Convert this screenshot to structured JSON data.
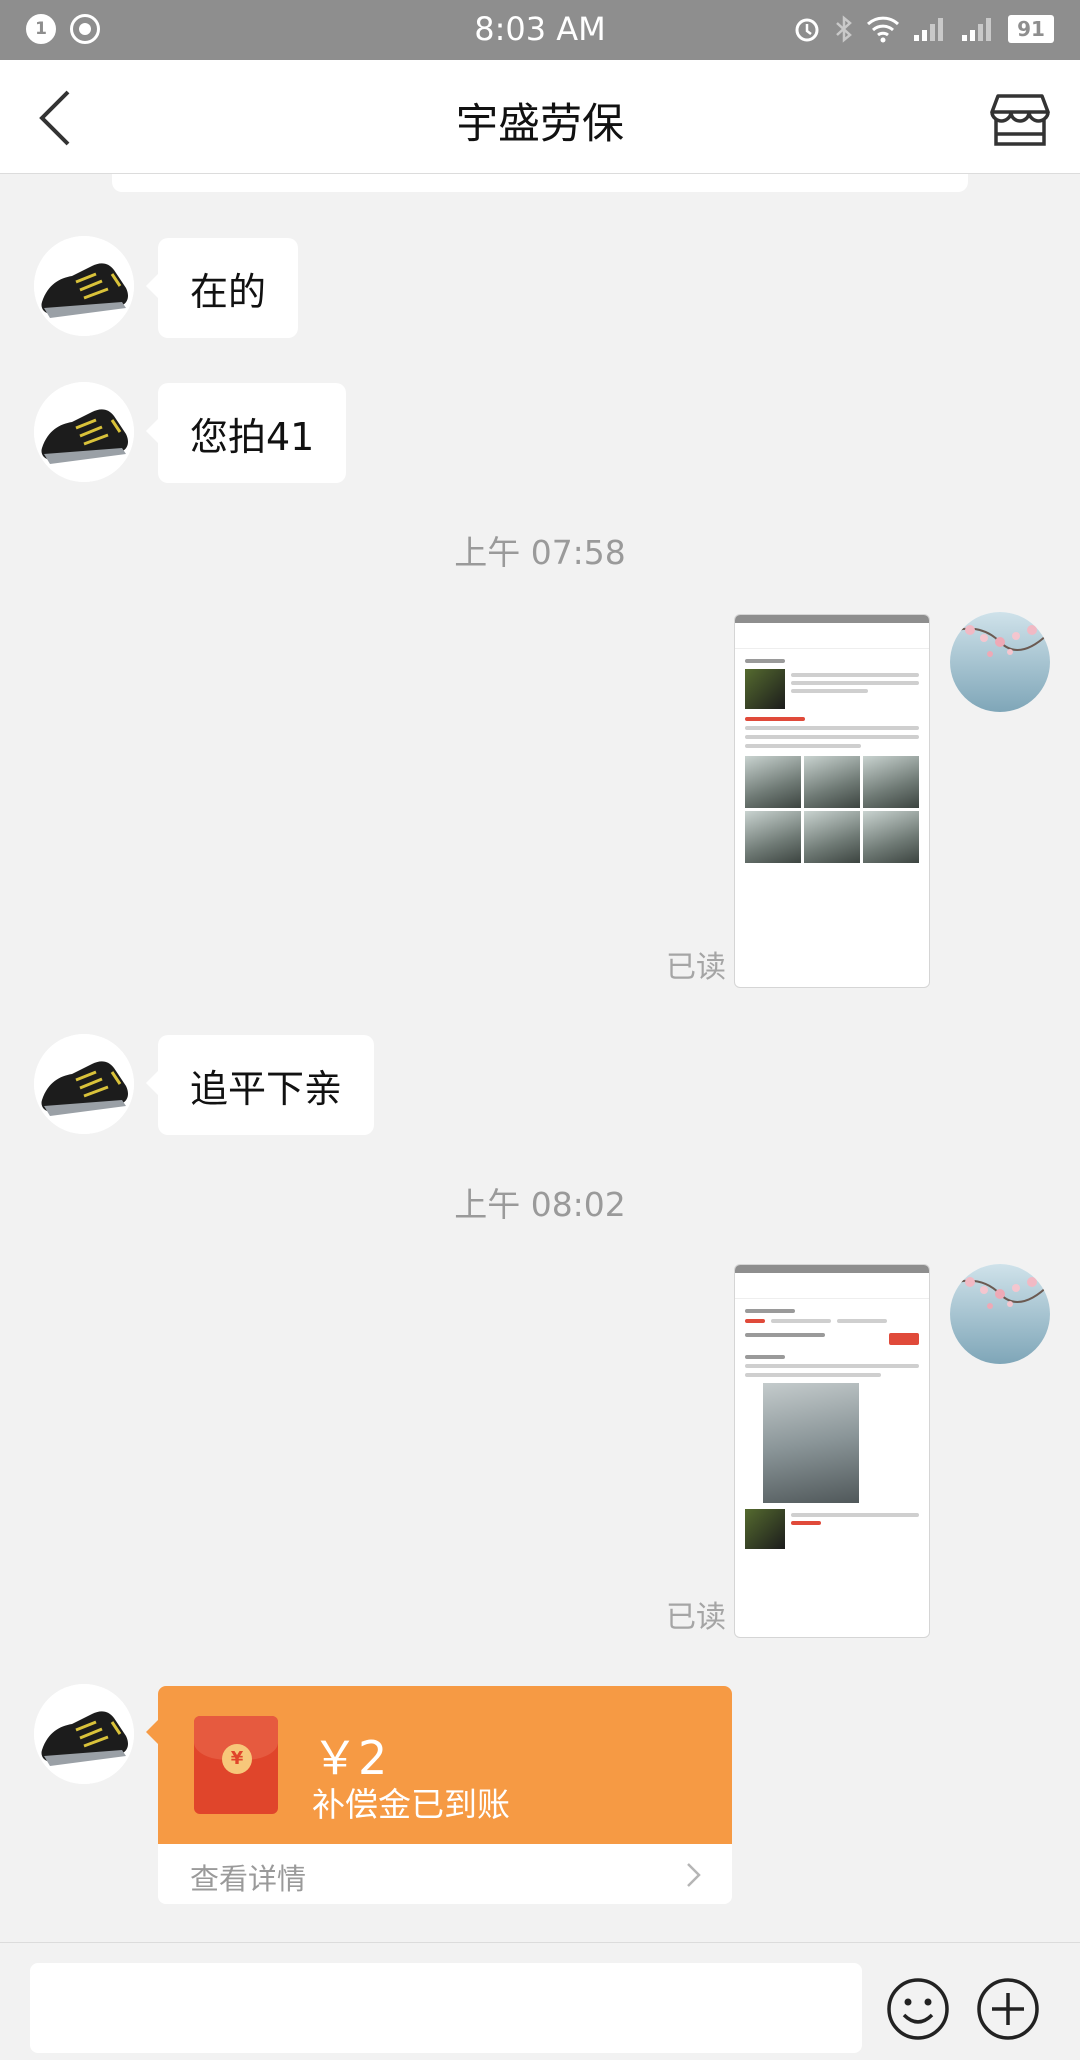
{
  "status_bar": {
    "notification_count": "1",
    "time": "8:03 AM",
    "battery": "91",
    "icons": [
      "alarm-icon",
      "bluetooth-icon",
      "wifi-icon",
      "signal-icon",
      "signal-icon",
      "battery-icon"
    ]
  },
  "nav": {
    "title": "宇盛劳保",
    "back_icon": "chevron-left-icon",
    "shop_icon": "store-icon"
  },
  "messages": {
    "m1": "在的",
    "m2": "您拍41",
    "t1": "上午 07:58",
    "read1": "已读",
    "m3": "追平下亲",
    "t2": "上午 08:02",
    "read2": "已读"
  },
  "red_packet": {
    "amount": "￥2",
    "description": "补偿金已到账",
    "coin_symbol": "¥",
    "view_details": "查看详情"
  },
  "input": {
    "placeholder": "",
    "emoji_icon": "smiley-icon",
    "plus_icon": "plus-circle-icon"
  },
  "colors": {
    "red_packet": "#f69a44",
    "envelope": "#e0452b",
    "status_bar": "#8e8e8e"
  }
}
